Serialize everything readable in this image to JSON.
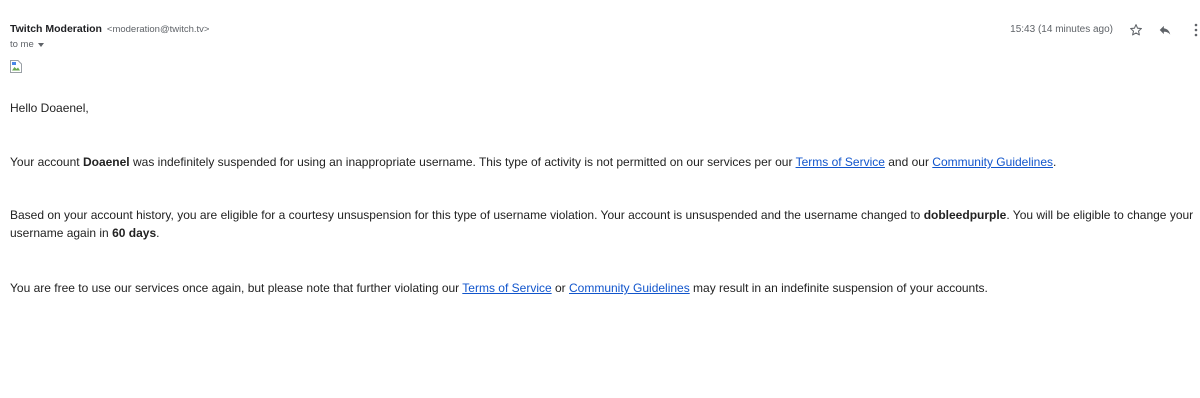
{
  "header": {
    "sender_name": "Twitch Moderation",
    "sender_email": "<moderation@twitch.tv>",
    "recipient": "to me",
    "timestamp": "15:43 (14 minutes ago)",
    "star_icon": "star-icon",
    "reply_icon": "reply-icon",
    "more_icon": "more-vert-icon"
  },
  "body": {
    "greeting": "Hello Doaenel,",
    "p1": {
      "t1": "Your account ",
      "username": "Doaenel",
      "t2": " was indefinitely suspended for using an inappropriate username. This type of activity is not permitted on our services per our ",
      "link1": "Terms of Service",
      "t3": " and our ",
      "link2": "Community Guidelines",
      "t4": "."
    },
    "p2": {
      "t1": "Based on your account history, you are eligible for a courtesy unsuspension for this type of username violation. Your account is unsuspended and the username changed to ",
      "new_username": "dobleedpurple",
      "t2": ". You will be eligible to change your username again in ",
      "days": "60 days",
      "t3": "."
    },
    "p3": {
      "t1": "You are free to use our services once again, but please note that further violating our ",
      "link1": "Terms of Service",
      "t2": " or ",
      "link2": "Community Guidelines",
      "t3": " may result in an indefinite suspension of your accounts."
    }
  },
  "colors": {
    "link": "#1155cc",
    "text": "#222222",
    "muted": "#5f6368"
  }
}
